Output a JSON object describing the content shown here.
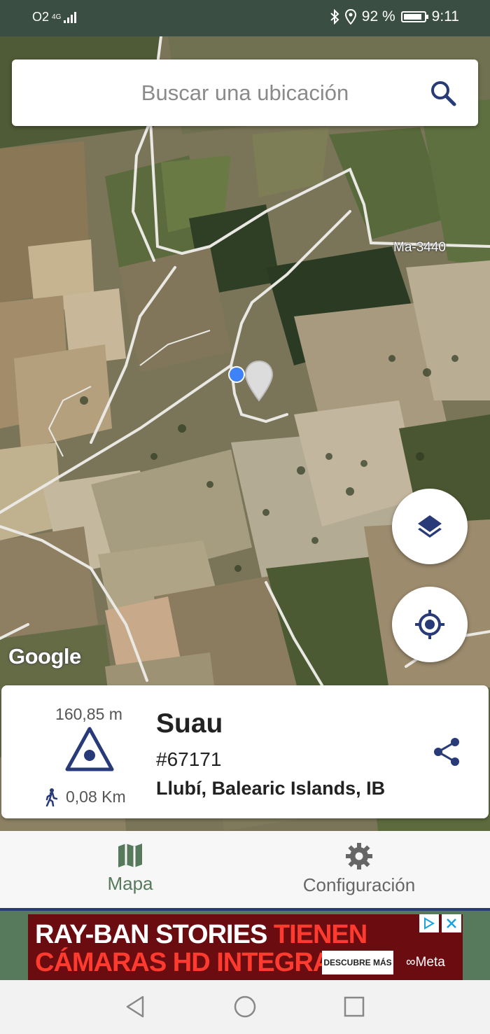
{
  "status_bar": {
    "carrier": "O2",
    "network": "4G",
    "battery_percent_text": "92 %",
    "battery_level": 0.92,
    "time": "9:11",
    "icons": [
      "bluetooth-icon",
      "location-icon",
      "signal-icon",
      "battery-icon"
    ]
  },
  "search": {
    "placeholder": "Buscar una ubicación",
    "icon": "search-icon"
  },
  "map": {
    "road_label": "Ma-3440",
    "attribution": "Google",
    "buttons": [
      "layers-icon",
      "my-location-icon"
    ]
  },
  "place_card": {
    "elevation": "160,85 m",
    "elevation_icon": "elevation-triangle-icon",
    "distance": "0,08 Km",
    "distance_icon": "walking-icon",
    "name": "Suau",
    "id": "#67171",
    "location": "Llubí, Balearic Islands, IB",
    "share_icon": "share-icon"
  },
  "bottom_nav": {
    "items": [
      {
        "label": "Mapa",
        "icon": "map-icon",
        "active": true
      },
      {
        "label": "Configuración",
        "icon": "gear-icon",
        "active": false
      }
    ]
  },
  "ad": {
    "line1_white": "RAY-BAN STORIES",
    "line1_red": "TIENEN",
    "line2": "CÁMARAS HD INTEGRADAS",
    "cta": "DESCUBRE MÁS",
    "brand": "∞Meta"
  },
  "colors": {
    "status_bar": "#3b4e43",
    "accent_green": "#567a5b",
    "navy": "#283b78",
    "user_dot": "#3e82f7"
  }
}
